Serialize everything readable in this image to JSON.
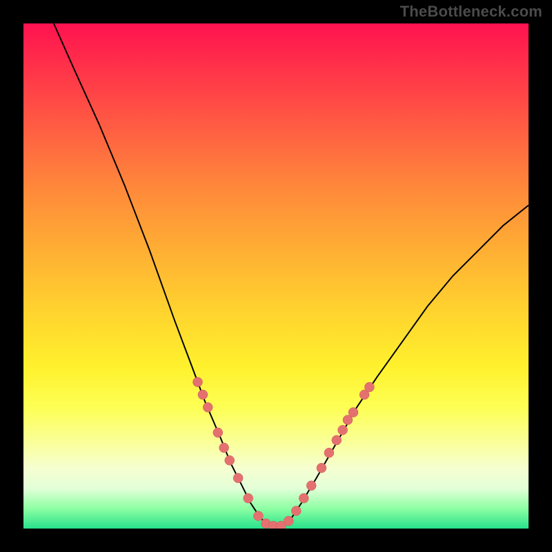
{
  "watermark": "TheBottleneck.com",
  "colors": {
    "frame": "#000000",
    "curve": "#000000",
    "dot_fill": "#e4716f",
    "dot_stroke": "#c85a58",
    "gradient_top": "#ff1250",
    "gradient_bottom": "#28e28b"
  },
  "chart_data": {
    "type": "line",
    "title": "",
    "xlabel": "",
    "ylabel": "",
    "xlim": [
      0,
      100
    ],
    "ylim": [
      0,
      100
    ],
    "annotations": [],
    "series": [
      {
        "name": "curve",
        "x": [
          6,
          10,
          15,
          20,
          25,
          30,
          33,
          36,
          39,
          41,
          43,
          45,
          47,
          49,
          51,
          53,
          55,
          58,
          62,
          66,
          70,
          75,
          80,
          85,
          90,
          95,
          100
        ],
        "y": [
          100,
          91,
          80,
          68,
          55,
          41,
          33,
          25,
          18,
          13,
          9,
          5,
          2,
          0.5,
          0.5,
          2,
          5,
          10,
          17,
          24,
          30,
          37,
          44,
          50,
          55,
          60,
          64
        ]
      }
    ],
    "markers": [
      {
        "x": 34.5,
        "y": 29
      },
      {
        "x": 35.5,
        "y": 26.5
      },
      {
        "x": 36.5,
        "y": 24
      },
      {
        "x": 38.5,
        "y": 19
      },
      {
        "x": 39.7,
        "y": 16
      },
      {
        "x": 40.8,
        "y": 13.5
      },
      {
        "x": 42.5,
        "y": 10
      },
      {
        "x": 44.5,
        "y": 6
      },
      {
        "x": 46.5,
        "y": 2.5
      },
      {
        "x": 48.0,
        "y": 1
      },
      {
        "x": 49.5,
        "y": 0.5
      },
      {
        "x": 51.0,
        "y": 0.5
      },
      {
        "x": 52.5,
        "y": 1.5
      },
      {
        "x": 54.0,
        "y": 3.5
      },
      {
        "x": 55.5,
        "y": 6
      },
      {
        "x": 57.0,
        "y": 8.5
      },
      {
        "x": 59.0,
        "y": 12
      },
      {
        "x": 60.5,
        "y": 15
      },
      {
        "x": 62.0,
        "y": 17.5
      },
      {
        "x": 63.2,
        "y": 19.5
      },
      {
        "x": 64.2,
        "y": 21.5
      },
      {
        "x": 65.3,
        "y": 23
      },
      {
        "x": 67.5,
        "y": 26.5
      },
      {
        "x": 68.5,
        "y": 28
      }
    ]
  }
}
